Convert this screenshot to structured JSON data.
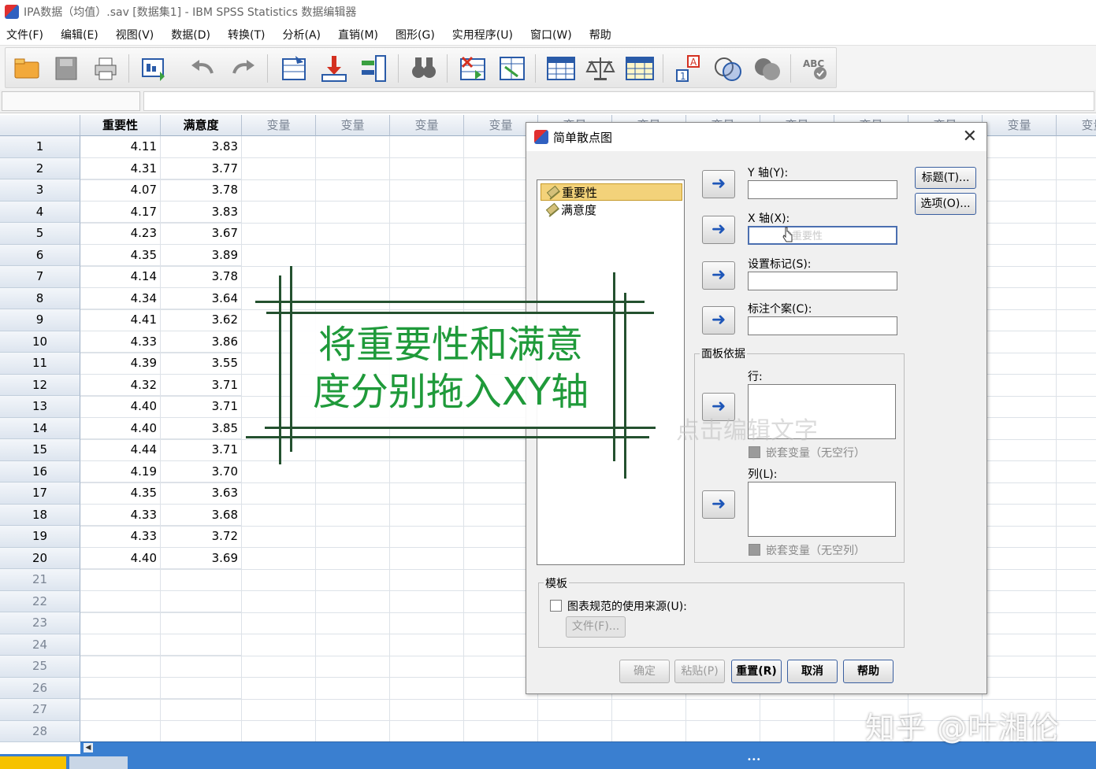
{
  "window": {
    "title": "IPA数据（均值）.sav [数据集1] - IBM SPSS Statistics 数据编辑器"
  },
  "menu": [
    "文件(F)",
    "编辑(E)",
    "视图(V)",
    "数据(D)",
    "转换(T)",
    "分析(A)",
    "直销(M)",
    "图形(G)",
    "实用程序(U)",
    "窗口(W)",
    "帮助"
  ],
  "toolbar": {
    "icons": [
      "open-folder-icon",
      "save-icon",
      "print-icon",
      "recall-dialog-icon",
      "undo-icon",
      "redo-icon",
      "goto-case-icon",
      "goto-variable-icon",
      "variables-icon",
      "find-icon",
      "insert-cases-icon",
      "insert-variable-icon",
      "split-file-icon",
      "weight-cases-icon",
      "select-cases-icon",
      "value-labels-icon",
      "use-sets-icon",
      "show-all-icon",
      "spelling-icon"
    ]
  },
  "grid": {
    "columns": [
      "重要性",
      "满意度",
      "变量",
      "变量",
      "变量",
      "变量",
      "变量",
      "变量",
      "变量",
      "变量",
      "变量",
      "变量",
      "变量",
      "变量"
    ],
    "rows": [
      {
        "n": "1",
        "a": "4.11",
        "b": "3.83"
      },
      {
        "n": "2",
        "a": "4.31",
        "b": "3.77"
      },
      {
        "n": "3",
        "a": "4.07",
        "b": "3.78"
      },
      {
        "n": "4",
        "a": "4.17",
        "b": "3.83"
      },
      {
        "n": "5",
        "a": "4.23",
        "b": "3.67"
      },
      {
        "n": "6",
        "a": "4.35",
        "b": "3.89"
      },
      {
        "n": "7",
        "a": "4.14",
        "b": "3.78"
      },
      {
        "n": "8",
        "a": "4.34",
        "b": "3.64"
      },
      {
        "n": "9",
        "a": "4.41",
        "b": "3.62"
      },
      {
        "n": "10",
        "a": "4.33",
        "b": "3.86"
      },
      {
        "n": "11",
        "a": "4.39",
        "b": "3.55"
      },
      {
        "n": "12",
        "a": "4.32",
        "b": "3.71"
      },
      {
        "n": "13",
        "a": "4.40",
        "b": "3.71"
      },
      {
        "n": "14",
        "a": "4.40",
        "b": "3.85"
      },
      {
        "n": "15",
        "a": "4.44",
        "b": "3.71"
      },
      {
        "n": "16",
        "a": "4.19",
        "b": "3.70"
      },
      {
        "n": "17",
        "a": "4.35",
        "b": "3.63"
      },
      {
        "n": "18",
        "a": "4.33",
        "b": "3.68"
      },
      {
        "n": "19",
        "a": "4.33",
        "b": "3.72"
      },
      {
        "n": "20",
        "a": "4.40",
        "b": "3.69"
      },
      {
        "n": "21",
        "a": "",
        "b": ""
      },
      {
        "n": "22",
        "a": "",
        "b": ""
      },
      {
        "n": "23",
        "a": "",
        "b": ""
      },
      {
        "n": "24",
        "a": "",
        "b": ""
      },
      {
        "n": "25",
        "a": "",
        "b": ""
      },
      {
        "n": "26",
        "a": "",
        "b": ""
      },
      {
        "n": "27",
        "a": "",
        "b": ""
      },
      {
        "n": "28",
        "a": "",
        "b": ""
      }
    ]
  },
  "dialog": {
    "title": "简单散点图",
    "variables": [
      "重要性",
      "满意度"
    ],
    "y_axis_label": "Y 轴(Y):",
    "x_axis_label": "X 轴(X):",
    "x_axis_drag_text": "重要性",
    "set_markers_label": "设置标记(S):",
    "label_cases_label": "标注个案(C):",
    "title_button": "标题(T)...",
    "options_button": "选项(O)...",
    "panel_group": "面板依据",
    "rows_label": "行:",
    "nest_rows_label": "嵌套变量（无空行）",
    "cols_label": "列(L):",
    "nest_cols_label": "嵌套变量（无空列）",
    "template_group": "模板",
    "template_check_label": "图表规范的使用来源(U):",
    "file_button": "文件(F)...",
    "ok_button": "确定",
    "paste_button": "粘贴(P)",
    "reset_button": "重置(R)",
    "cancel_button": "取消",
    "help_button": "帮助"
  },
  "overlay": {
    "line1": "将重要性和满意",
    "line2": "度分别拖入XY轴",
    "ghost": "点击编辑文字"
  },
  "tabs": {
    "data_view": "",
    "variable_view": ""
  },
  "watermark": "知乎 @叶湘伦",
  "colors": {
    "grid_header": "#dfe6ef",
    "scroll_bar": "#3a7fd0",
    "overlay_text": "#1f9a3a",
    "overlay_lines": "#24512f",
    "selected_var": "#f3d27a",
    "arrow": "#1e56b8"
  }
}
